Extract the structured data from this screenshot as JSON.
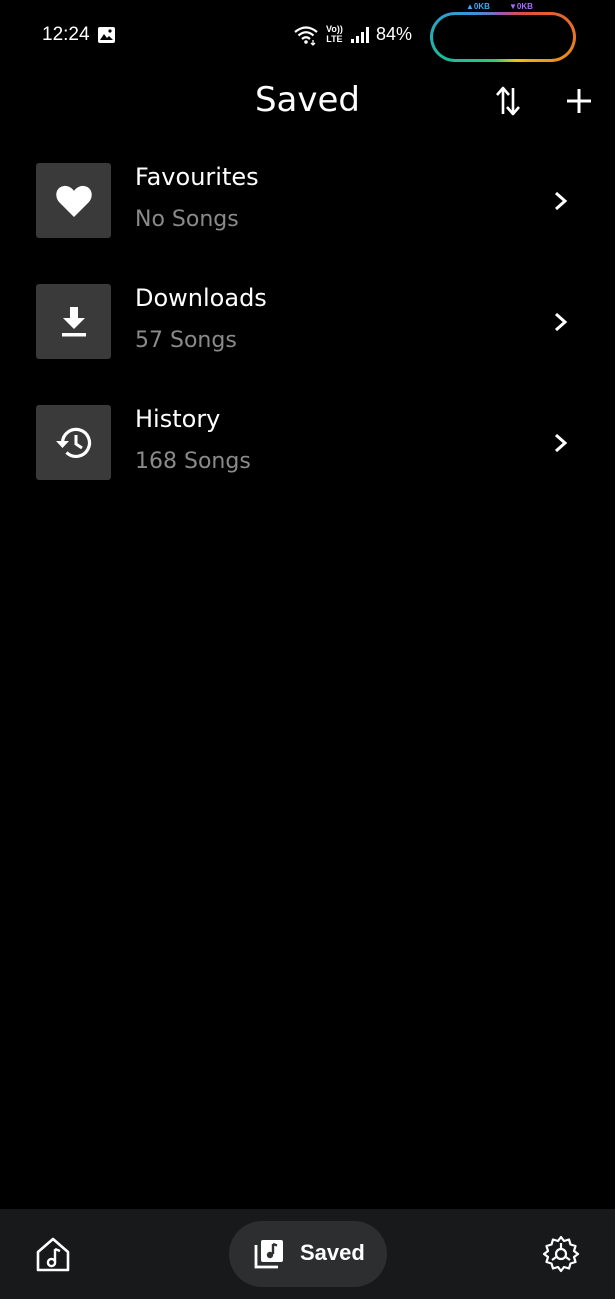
{
  "status_bar": {
    "time": "12:24",
    "volte_top": "Vo))",
    "volte_bottom": "LTE",
    "battery": "84%",
    "net_up": "▲0KB",
    "net_down": "▼0KB",
    "icons": [
      "gallery-icon",
      "wifi-icon",
      "signal-icon"
    ]
  },
  "header": {
    "title": "Saved",
    "sort_icon": "sort-arrows-icon",
    "add_icon": "plus-icon"
  },
  "playlists": [
    {
      "title": "Favourites",
      "subtitle": "No Songs",
      "icon": "heart-icon"
    },
    {
      "title": "Downloads",
      "subtitle": "57 Songs",
      "icon": "download-icon"
    },
    {
      "title": "History",
      "subtitle": "168 Songs",
      "icon": "history-icon"
    }
  ],
  "bottom_nav": {
    "home_icon": "home-music-icon",
    "saved_label": "Saved",
    "saved_icon": "library-music-icon",
    "settings_icon": "settings-icon",
    "active_tab": "Saved"
  },
  "colors": {
    "background": "#000000",
    "thumb_bg": "#3a3a3a",
    "subtitle": "#8a8a8a",
    "nav_bg": "#17191b",
    "nav_active_bg": "#2c2e30"
  }
}
